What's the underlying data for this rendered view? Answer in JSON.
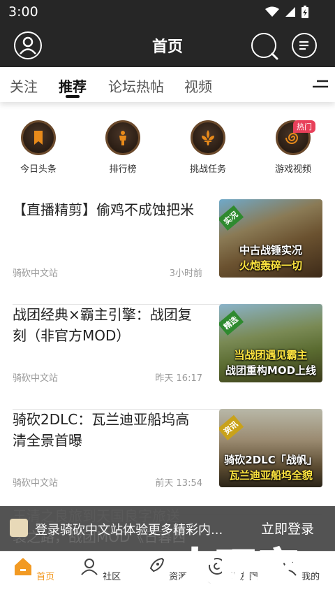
{
  "status": {
    "time": "3:00"
  },
  "appbar": {
    "title": "首页"
  },
  "tabs": [
    {
      "label": "关注"
    },
    {
      "label": "推荐"
    },
    {
      "label": "论坛热帖"
    },
    {
      "label": "视频"
    }
  ],
  "quick": [
    {
      "label": "今日头条",
      "icon": "bookmark-icon"
    },
    {
      "label": "排行榜",
      "icon": "figure-icon"
    },
    {
      "label": "挑战任务",
      "icon": "fleur-de-lis-icon"
    },
    {
      "label": "游戏视频",
      "icon": "spiral-icon"
    }
  ],
  "hot_badge": "热门",
  "articles": [
    {
      "title": "【直播精剪】偷鸡不成蚀把米",
      "source": "骑砍中文站",
      "time": "3小时前",
      "thumb": {
        "tag": "实况",
        "cap1": "中古战锤实况",
        "cap2": "火炮轰碎一切"
      }
    },
    {
      "title": "战团经典×霸主引擎：战团复刻（非官方MOD）",
      "source": "骑砍中文站",
      "time": "昨天 16:17",
      "thumb": {
        "tag": "精选",
        "cap1": "当战团遇见霸主",
        "cap2": "战团重构MOD上线"
      }
    },
    {
      "title": "骑砍2DLC：瓦兰迪亚船坞高清全景首曝",
      "source": "骑砍中文站",
      "time": "前天 13:54",
      "thumb": {
        "tag": "资讯",
        "cap1": "骑砍2DLC「战帆」",
        "cap2": "瓦兰迪亚船坞全貌"
      }
    }
  ],
  "banner": {
    "behind1": "王清之良旅到天国良字旅送",
    "behind2": "袭之路，战团MOD《日暮西",
    "text": "登录骑砍中文站体验更多精彩内...",
    "login": "立即登录"
  },
  "nav": [
    {
      "label": "首页"
    },
    {
      "label": "社区"
    },
    {
      "label": "资源"
    },
    {
      "label": "骑友圈"
    },
    {
      "label": "我的"
    }
  ],
  "watermark": "大玩家"
}
